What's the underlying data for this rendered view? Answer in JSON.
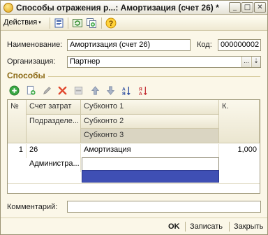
{
  "window": {
    "title": "Способы отражения р...: Амортизация (счет 26) *"
  },
  "toolbar": {
    "actions_label": "Действия",
    "actions_arrow": "▾"
  },
  "form": {
    "name_label": "Наименование:",
    "name_value": "Амортизация (счет 26)",
    "code_label": "Код:",
    "code_value": "000000002",
    "org_label": "Организация:",
    "org_value": "Партнер",
    "comment_label": "Комментарий:",
    "comment_value": ""
  },
  "section": {
    "title": "Способы"
  },
  "table": {
    "headers": {
      "num": "№",
      "account": "Счет затрат",
      "subconto1": "Субконто 1",
      "k": "К.",
      "division": "Подразделе...",
      "subconto2": "Субконто 2",
      "subconto3": "Субконто 3"
    },
    "rows": [
      {
        "num": "1",
        "account": "26",
        "subconto1": "Амортизация",
        "k": "1,000",
        "division": "Администра...",
        "subconto2": "",
        "subconto3": ""
      }
    ]
  },
  "footer": {
    "ok": "OK",
    "save": "Записать",
    "close": "Закрыть"
  }
}
